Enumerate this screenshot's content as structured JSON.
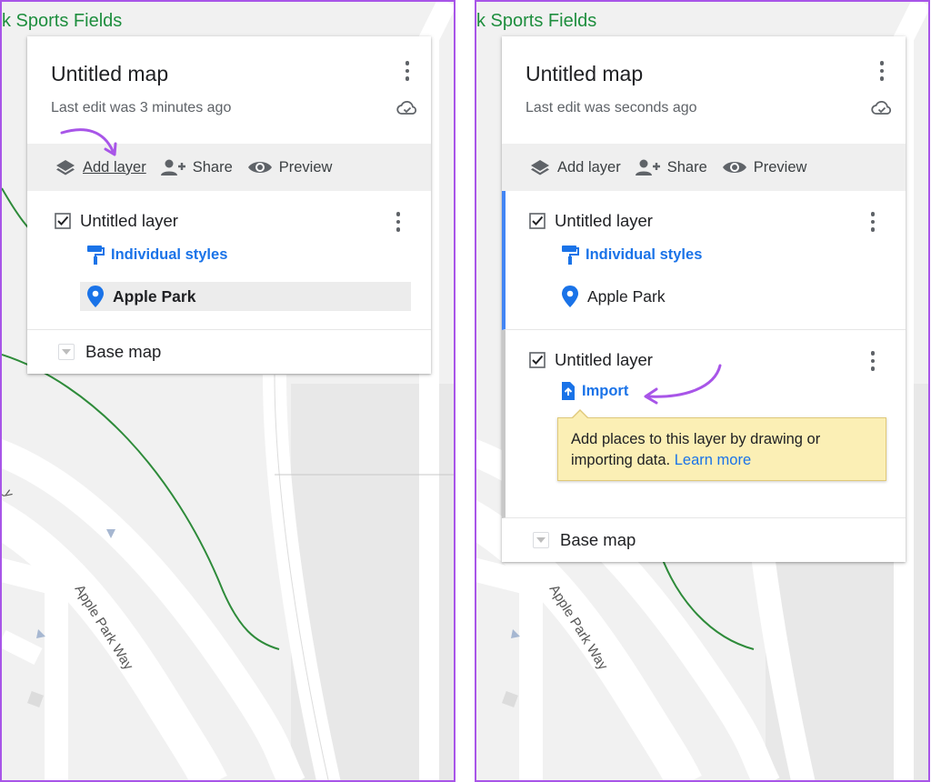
{
  "colors": {
    "accent": "#a855e8",
    "link": "#1a73e8",
    "map_text": "#1e8e3e",
    "road_green": "#2e8b3a"
  },
  "map": {
    "area_label": "k Sports Fields",
    "road_label": "Apple Park Way"
  },
  "left": {
    "title": "Untitled map",
    "last_edit": "Last edit was 3 minutes ago",
    "toolbar": {
      "add_layer": "Add layer",
      "share": "Share",
      "preview": "Preview"
    },
    "layer": {
      "name": "Untitled layer",
      "styles_link": "Individual styles",
      "place": "Apple Park"
    },
    "base_map": "Base map"
  },
  "right": {
    "title": "Untitled map",
    "last_edit": "Last edit was seconds ago",
    "toolbar": {
      "add_layer": "Add layer",
      "share": "Share",
      "preview": "Preview"
    },
    "layer1": {
      "name": "Untitled layer",
      "styles_link": "Individual styles",
      "place": "Apple Park"
    },
    "layer2": {
      "name": "Untitled layer",
      "import_link": "Import",
      "tooltip_text": "Add places to this layer by drawing or importing data.",
      "tooltip_link": "Learn more"
    },
    "base_map": "Base map"
  },
  "icons": [
    "layers-icon",
    "add-person-icon",
    "eye-icon",
    "cloud-icon",
    "paint-roller-icon",
    "place-pin-icon",
    "import-icon",
    "checkbox-icon",
    "kebab-menu-icon",
    "chevron-down-icon"
  ]
}
